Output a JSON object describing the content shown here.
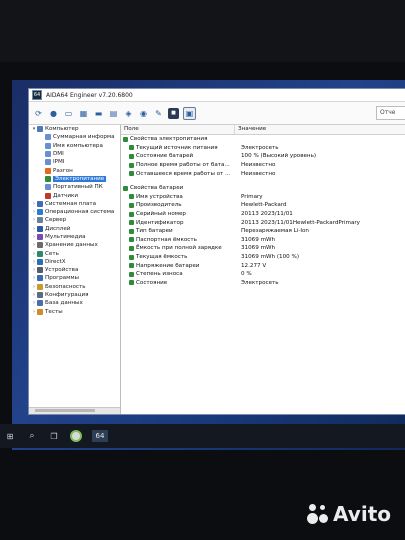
{
  "window": {
    "title": "AIDA64 Engineer v7.20.6800",
    "icon_text": "64"
  },
  "toolbar": {
    "buttons": [
      "refresh-icon",
      "user-icon",
      "monitor-icon",
      "chip-icon",
      "memory-icon",
      "storage-icon",
      "network-icon",
      "disk-icon",
      "tools-icon",
      "benchmark-icon",
      "report-icon"
    ],
    "report_label": "Отче"
  },
  "tree": {
    "items": [
      {
        "label": "Компьютер",
        "level": 0,
        "expander": "▾",
        "color": "#4f79b9"
      },
      {
        "label": "Суммарная информа",
        "level": 1,
        "expander": "",
        "color": "#6a8fd1"
      },
      {
        "label": "Имя компьютера",
        "level": 1,
        "expander": "",
        "color": "#6a8fd1"
      },
      {
        "label": "DMI",
        "level": 1,
        "expander": "",
        "color": "#6a8fd1"
      },
      {
        "label": "IPMI",
        "level": 1,
        "expander": "",
        "color": "#6a8fd1"
      },
      {
        "label": "Разгон",
        "level": 1,
        "expander": "",
        "color": "#e26a1b"
      },
      {
        "label": "Электропитание",
        "level": 1,
        "expander": "",
        "color": "#2e8b3a",
        "selected": true
      },
      {
        "label": "Портативный ПК",
        "level": 1,
        "expander": "",
        "color": "#6a8fd1"
      },
      {
        "label": "Датчики",
        "level": 1,
        "expander": "",
        "color": "#c0392b"
      },
      {
        "label": "Системная плата",
        "level": 0,
        "expander": "›",
        "color": "#3e6db5"
      },
      {
        "label": "Операционная система",
        "level": 0,
        "expander": "›",
        "color": "#2f7bd0"
      },
      {
        "label": "Сервер",
        "level": 0,
        "expander": "›",
        "color": "#6b7f99"
      },
      {
        "label": "Дисплей",
        "level": 0,
        "expander": "›",
        "color": "#2b5aa0"
      },
      {
        "label": "Мультимедиа",
        "level": 0,
        "expander": "›",
        "color": "#7a4bb0"
      },
      {
        "label": "Хранение данных",
        "level": 0,
        "expander": "›",
        "color": "#6b6b6b"
      },
      {
        "label": "Сеть",
        "level": 0,
        "expander": "›",
        "color": "#2a8a6a"
      },
      {
        "label": "DirectX",
        "level": 0,
        "expander": "›",
        "color": "#2b6fb5"
      },
      {
        "label": "Устройства",
        "level": 0,
        "expander": "›",
        "color": "#555d6b"
      },
      {
        "label": "Программы",
        "level": 0,
        "expander": "›",
        "color": "#3a6bb0"
      },
      {
        "label": "Безопасность",
        "level": 0,
        "expander": "›",
        "color": "#c99a2e"
      },
      {
        "label": "Конфигурация",
        "level": 0,
        "expander": "›",
        "color": "#5a6b80"
      },
      {
        "label": "База данных",
        "level": 0,
        "expander": "›",
        "color": "#4a6fa8"
      },
      {
        "label": "Тесты",
        "level": 0,
        "expander": "›",
        "color": "#d48a2a"
      }
    ]
  },
  "details": {
    "col_field": "Поле",
    "col_value": "Значение",
    "sections": [
      {
        "title": "Свойства электропитания",
        "rows": [
          {
            "k": "Текущий источник питания",
            "v": "Электросеть"
          },
          {
            "k": "Состояние батарей",
            "v": "100 % (Высокий уровень)"
          },
          {
            "k": "Полное время работы от бата...",
            "v": "Неизвестно"
          },
          {
            "k": "Оставшееся время работы от ...",
            "v": "Неизвестно"
          }
        ]
      },
      {
        "title": "Свойства батареи",
        "rows": [
          {
            "k": "Имя устройства",
            "v": "Primary"
          },
          {
            "k": "Производитель",
            "v": "Hewlett-Packard"
          },
          {
            "k": "Серийный номер",
            "v": "20113 2023/11/01"
          },
          {
            "k": "Идентификатор",
            "v": "20113 2023/11/01Hewlett-PackardPrimary"
          },
          {
            "k": "Тип батареи",
            "v": "Перезаряжаемая Li-Ion"
          },
          {
            "k": "Паспортная ёмкость",
            "v": "31069 mWh"
          },
          {
            "k": "Ёмкость при полной зарядке",
            "v": "31069 mWh"
          },
          {
            "k": "Текущая ёмкость",
            "v": "31069 mWh  (100 %)"
          },
          {
            "k": "Напряжение батареи",
            "v": "12.277 V"
          },
          {
            "k": "Степень износа",
            "v": "0 %"
          },
          {
            "k": "Состояние",
            "v": "Электросеть"
          }
        ]
      }
    ]
  },
  "taskbar": {
    "items": [
      "windows-icon",
      "search-icon",
      "task-view-icon",
      "chrome-icon",
      "aida64-icon"
    ],
    "aida_label": "64"
  },
  "watermark": {
    "text": "Avito"
  }
}
